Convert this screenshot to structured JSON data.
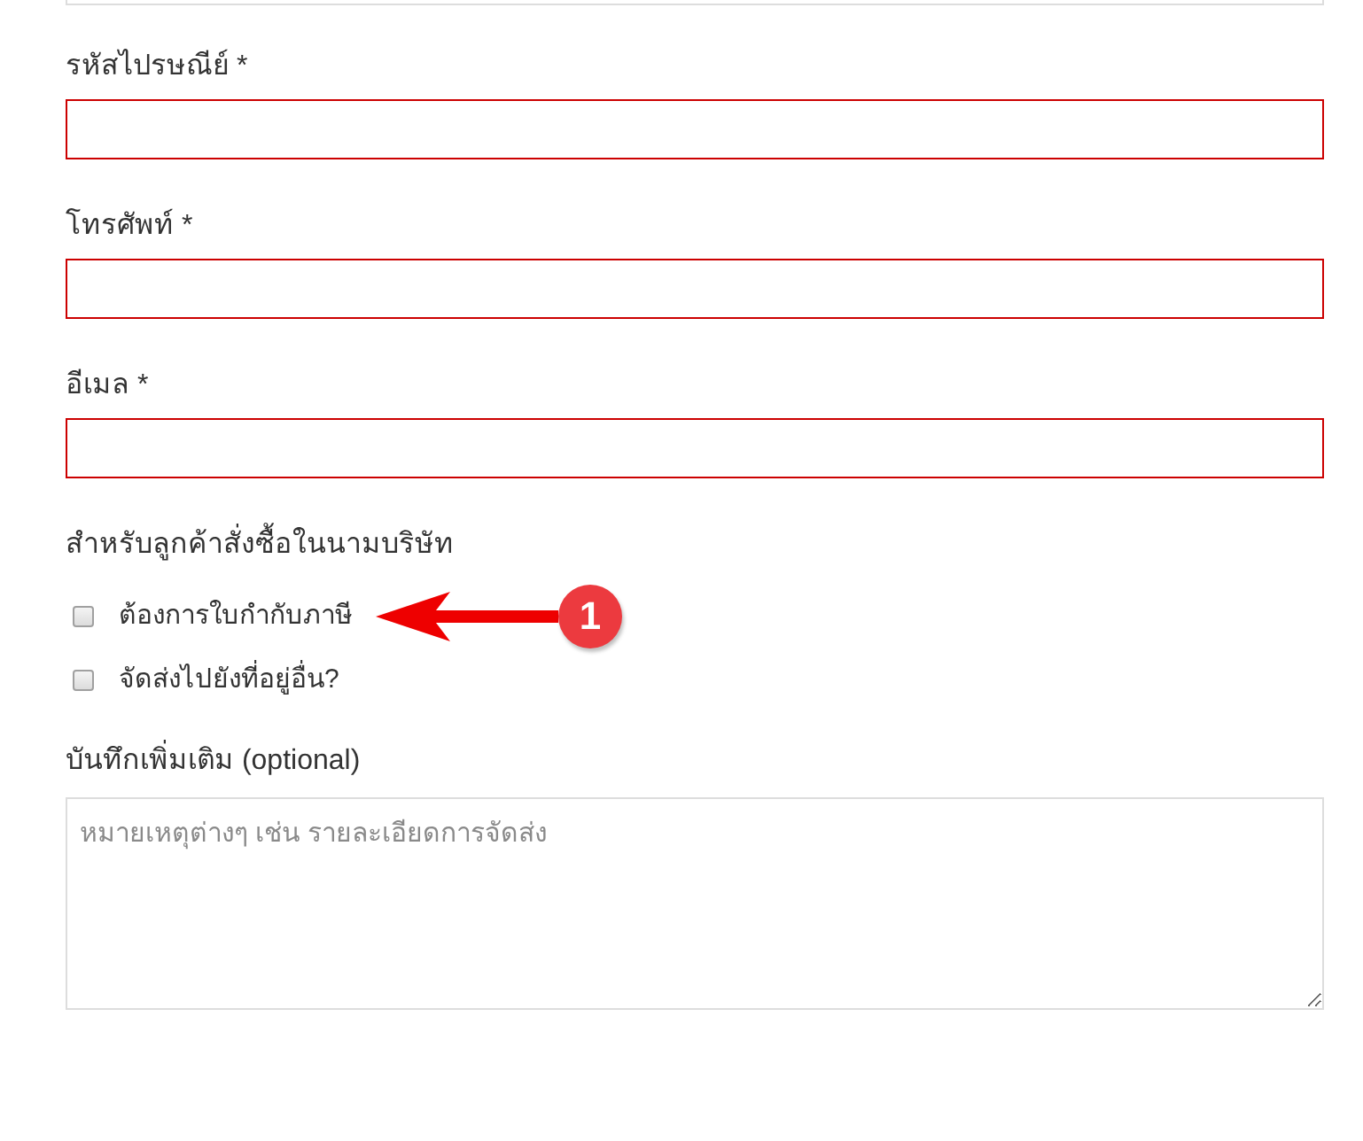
{
  "form": {
    "top_field": {
      "error": false
    },
    "fields": [
      {
        "label": "รหัสไปรษณีย์ *",
        "error": true
      },
      {
        "label": "โทรศัพท์ *",
        "error": true
      },
      {
        "label": "อีเมล *",
        "error": true
      }
    ],
    "company_section": {
      "heading": "สำหรับลูกค้าสั่งซื้อในนามบริษัท",
      "options": [
        {
          "label": "ต้องการใบกำกับภาษี",
          "checked": false,
          "annotation": "1"
        },
        {
          "label": "จัดส่งไปยังที่อยู่อื่น?",
          "checked": false
        }
      ]
    },
    "notes": {
      "label": "บันทึกเพิ่มเติม (optional)",
      "placeholder": "หมายเหตุต่างๆ เช่น รายละเอียดการจัดส่ง"
    }
  }
}
